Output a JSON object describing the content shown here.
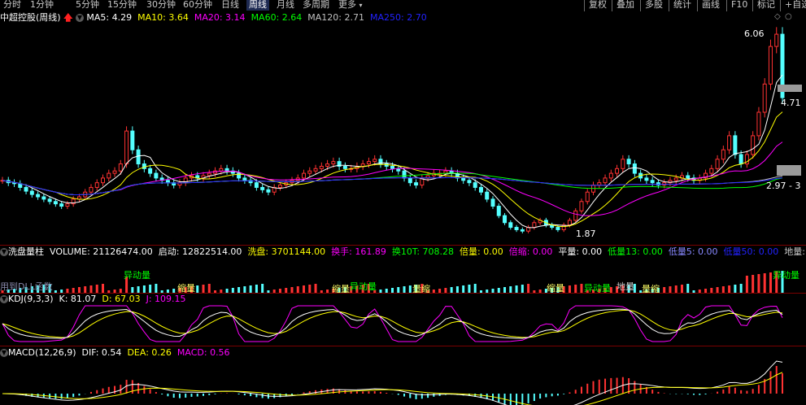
{
  "toolbar": {
    "tabs": [
      "分时",
      "1分钟",
      "5分钟",
      "15分钟",
      "30分钟",
      "60分钟",
      "日线",
      "周线",
      "月线",
      "多周期",
      "更多"
    ],
    "active_tab": "周线",
    "right_buttons": [
      "复权",
      "叠加",
      "多股",
      "统计",
      "画线",
      "F10",
      "标记",
      "+自选"
    ]
  },
  "main_header": {
    "stock_name": "中超控股(周线)",
    "ma": [
      {
        "label": "MA5: 4.29",
        "color": "#ffffff"
      },
      {
        "label": "MA10: 3.64",
        "color": "#ffff00"
      },
      {
        "label": "MA20: 3.14",
        "color": "#ff00ff"
      },
      {
        "label": "MA60: 2.64",
        "color": "#00ff00"
      },
      {
        "label": "MA120: 2.71",
        "color": "#c0c0c0"
      },
      {
        "label": "MA250: 2.70",
        "color": "#2222ff"
      }
    ]
  },
  "price_annotations": {
    "high": "6.06",
    "low": "1.87",
    "current": "4.71",
    "range_label": "2.97 - 3"
  },
  "volume_header": {
    "name": "洗盘量柱",
    "items": [
      {
        "label": "VOLUME: 21126474.00",
        "color": "#ffffff"
      },
      {
        "label": "启动: 12822514.00",
        "color": "#ffffff"
      },
      {
        "label": "洗盘: 3701144.00",
        "color": "#ffff00"
      },
      {
        "label": "换手: 161.89",
        "color": "#ff00ff"
      },
      {
        "label": "换10T: 708.28",
        "color": "#00ff00"
      },
      {
        "label": "倍量: 0.00",
        "color": "#ffff00"
      },
      {
        "label": "倍缩: 0.00",
        "color": "#ff00ff"
      },
      {
        "label": "平量: 0.00",
        "color": "#ffffff"
      },
      {
        "label": "低量13: 0.00",
        "color": "#00ff00"
      },
      {
        "label": "低量5: 0.00",
        "color": "#8888ff"
      },
      {
        "label": "低量50: 0.00",
        "color": "#2222ff"
      },
      {
        "label": "地量: 0",
        "color": "#c8c8c8"
      }
    ],
    "overlay_texts": [
      "用到DLL函数",
      "异动量",
      "缩量",
      "异动量",
      "缩量",
      "量缩",
      "缩量",
      "异动量",
      "地量",
      "异动量",
      "量缩",
      "异动量"
    ]
  },
  "kdj_header": {
    "name": "KDJ(9,3,3)",
    "items": [
      {
        "label": "K: 81.07",
        "color": "#ffffff"
      },
      {
        "label": "D: 67.03",
        "color": "#ffff00"
      },
      {
        "label": "J: 109.15",
        "color": "#ff00ff"
      }
    ]
  },
  "macd_header": {
    "name": "MACD(12,26,9)",
    "items": [
      {
        "label": "DIF: 0.54",
        "color": "#ffffff"
      },
      {
        "label": "DEA: 0.26",
        "color": "#ffff00"
      },
      {
        "label": "MACD: 0.56",
        "color": "#ff00ff"
      }
    ]
  },
  "chart_data": {
    "type": "candlestick",
    "title": "中超控股(周线)",
    "weeks": 140,
    "close": [
      2.95,
      2.9,
      2.88,
      2.8,
      2.72,
      2.65,
      2.6,
      2.55,
      2.5,
      2.45,
      2.4,
      2.45,
      2.55,
      2.6,
      2.7,
      2.8,
      2.9,
      3.0,
      3.1,
      3.15,
      3.3,
      4.0,
      3.6,
      3.3,
      3.2,
      3.1,
      3.0,
      2.95,
      2.9,
      2.85,
      2.9,
      3.0,
      3.05,
      3.0,
      3.05,
      3.1,
      3.15,
      3.2,
      3.15,
      3.1,
      3.0,
      2.95,
      2.9,
      2.8,
      2.75,
      2.7,
      2.8,
      2.85,
      2.9,
      2.95,
      3.0,
      3.1,
      3.15,
      3.2,
      3.25,
      3.3,
      3.35,
      3.25,
      3.2,
      3.2,
      3.25,
      3.3,
      3.35,
      3.4,
      3.3,
      3.25,
      3.2,
      3.15,
      3.0,
      2.9,
      2.85,
      3.0,
      3.05,
      3.1,
      3.1,
      3.15,
      3.1,
      3.0,
      2.95,
      2.9,
      2.8,
      2.7,
      2.55,
      2.4,
      2.2,
      2.05,
      1.95,
      1.9,
      1.87,
      1.95,
      2.05,
      2.1,
      2.0,
      1.95,
      1.9,
      2.0,
      2.1,
      2.3,
      2.5,
      2.7,
      2.85,
      2.9,
      3.0,
      3.1,
      3.2,
      3.4,
      3.3,
      3.1,
      3.0,
      2.95,
      2.9,
      2.85,
      2.9,
      2.95,
      3.0,
      3.05,
      3.0,
      2.95,
      3.0,
      3.1,
      3.2,
      3.4,
      3.6,
      3.9,
      3.5,
      3.3,
      3.5,
      3.9,
      4.4,
      5.0,
      5.8,
      6.06,
      4.71
    ],
    "ma": {
      "MA5": 4.29,
      "MA10": 3.64,
      "MA20": 3.14,
      "MA60": 2.64,
      "MA120": 2.71,
      "MA250": 2.7
    },
    "volume": {
      "VOLUME": 21126474,
      "启动": 12822514,
      "洗盘": 3701144
    },
    "kdj": {
      "K": 81.07,
      "D": 67.03,
      "J": 109.15
    },
    "macd": {
      "DIF": 0.54,
      "DEA": 0.26,
      "MACD": 0.56
    }
  }
}
